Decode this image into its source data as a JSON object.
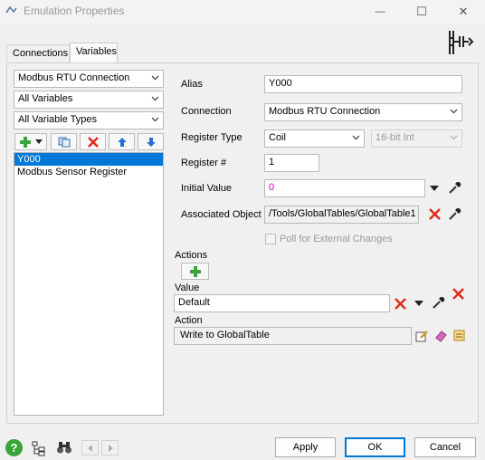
{
  "window": {
    "title": "Emulation Properties",
    "close_glyph": "✕",
    "max_glyph": "☐",
    "min_glyph": "—"
  },
  "tabs": [
    {
      "label": "Connections",
      "active": false
    },
    {
      "label": "Variables",
      "active": true
    }
  ],
  "left": {
    "connection_select": "Modbus RTU Connection",
    "variables_filter": "All Variables",
    "types_filter": "All Variable Types",
    "items": [
      "Y000",
      "Modbus Sensor Register"
    ],
    "selected_index": 0
  },
  "form": {
    "alias_label": "Alias",
    "alias_value": "Y000",
    "connection_label": "Connection",
    "connection_value": "Modbus RTU Connection",
    "register_type_label": "Register Type",
    "register_type_value": "Coil",
    "data_type_value": "16-bit Int",
    "register_num_label": "Register #",
    "register_num_value": "1",
    "initial_value_label": "Initial Value",
    "initial_value_value": "0",
    "associated_object_label": "Associated Object",
    "associated_object_value": "/Tools/GlobalTables/GlobalTable1",
    "poll_label": "Poll for External Changes",
    "poll_checked": false
  },
  "actions": {
    "actions_label": "Actions",
    "value_label": "Value",
    "value_value": "Default",
    "action_label": "Action",
    "action_value": "Write to GlobalTable"
  },
  "footer": {
    "apply": "Apply",
    "ok": "OK",
    "cancel": "Cancel"
  },
  "colors": {
    "accent": "#0078d7",
    "delete_red": "#e0271b",
    "add_green": "#3aa53a",
    "initial_value_text": "#c800c8"
  }
}
